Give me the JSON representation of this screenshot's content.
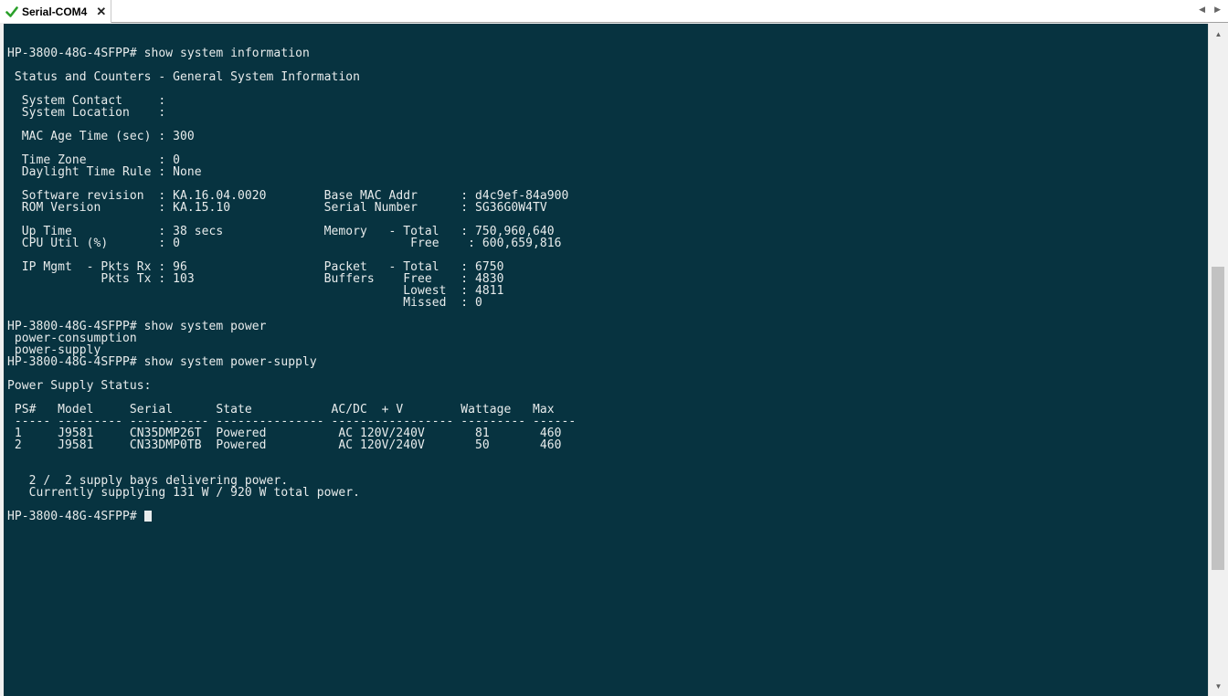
{
  "tab": {
    "title": "Serial-COM4",
    "close_glyph": "✕",
    "status_icon": "checkmark-icon",
    "status_color": "#2aa02a"
  },
  "nav": {
    "prev": "◀",
    "next": "▶"
  },
  "scrollbar": {
    "up": "▲",
    "down": "▼"
  },
  "terminal": {
    "background": "#073340",
    "foreground": "#e8ecec",
    "lines": [
      "HP-3800-48G-4SFPP# show system information",
      "",
      " Status and Counters - General System Information",
      "",
      "  System Contact     :",
      "  System Location    :",
      "",
      "  MAC Age Time (sec) : 300",
      "",
      "  Time Zone          : 0",
      "  Daylight Time Rule : None",
      "",
      "  Software revision  : KA.16.04.0020        Base MAC Addr      : d4c9ef-84a900",
      "  ROM Version        : KA.15.10             Serial Number      : SG36G0W4TV",
      "",
      "  Up Time            : 38 secs              Memory   - Total   : 750,960,640",
      "  CPU Util (%)       : 0                                Free    : 600,659,816",
      "",
      "  IP Mgmt  - Pkts Rx : 96                   Packet   - Total   : 6750",
      "             Pkts Tx : 103                  Buffers    Free    : 4830",
      "                                                       Lowest  : 4811",
      "                                                       Missed  : 0",
      "",
      "HP-3800-48G-4SFPP# show system power",
      " power-consumption",
      " power-supply",
      "HP-3800-48G-4SFPP# show system power-supply",
      "",
      "Power Supply Status:",
      "",
      " PS#   Model     Serial      State           AC/DC  + V        Wattage   Max",
      " ----- --------- ----------- --------------- ----------------- --------- ------",
      " 1     J9581     CN35DMP26T  Powered          AC 120V/240V       81       460",
      " 2     J9581     CN33DMP0TB  Powered          AC 120V/240V       50       460",
      "",
      "",
      "   2 /  2 supply bays delivering power.",
      "   Currently supplying 131 W / 920 W total power.",
      ""
    ],
    "prompt": "HP-3800-48G-4SFPP# "
  }
}
